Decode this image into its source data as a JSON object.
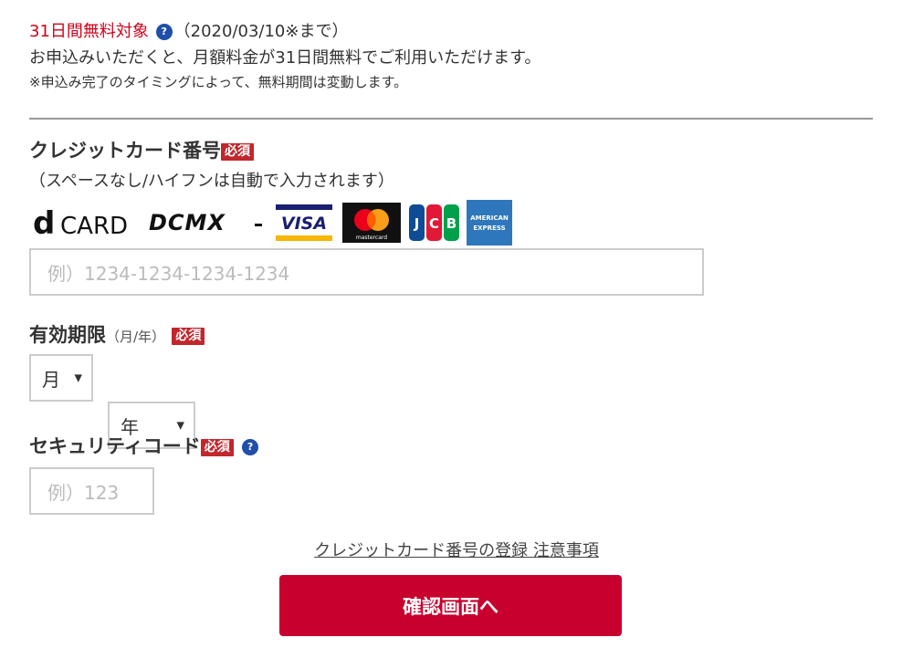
{
  "notice": {
    "trial_label": "31日間無料対象",
    "trial_period": "（2020/03/10※まで）",
    "description": "お申込みいただくと、月額料金が31日間無料でご利用いただけます。",
    "note": "※申込み完了のタイミングによって、無料期間は変動します。"
  },
  "help_icon_glyph": "?",
  "required_label": "必須",
  "card_number": {
    "label": "クレジットカード番号",
    "hint": "（スペースなし/ハイフンは自動で入力されます）",
    "placeholder": "例）1234-1234-1234-1234",
    "brands": [
      {
        "name": "d CARD",
        "icon": "dcard-logo"
      },
      {
        "name": "DCMX",
        "icon": "dcmx-logo"
      },
      {
        "name": "VISA",
        "icon": "visa-logo"
      },
      {
        "name": "mastercard",
        "icon": "mastercard-logo"
      },
      {
        "name": "JCB",
        "icon": "jcb-logo"
      },
      {
        "name": "AMERICAN EXPRESS",
        "icon": "amex-logo"
      }
    ]
  },
  "expiry": {
    "label": "有効期限",
    "format": "（月/年）",
    "month_value": "月",
    "year_value": "年"
  },
  "security": {
    "label": "セキュリティコード",
    "placeholder": "例）123"
  },
  "notes_link": "クレジットカード番号の登録 注意事項",
  "submit_label": "確認画面へ",
  "colors": {
    "accent_red": "#c8002e",
    "required_badge": "#c1272d",
    "help_icon": "#1f4fa8",
    "trial_text": "#d0021b"
  }
}
